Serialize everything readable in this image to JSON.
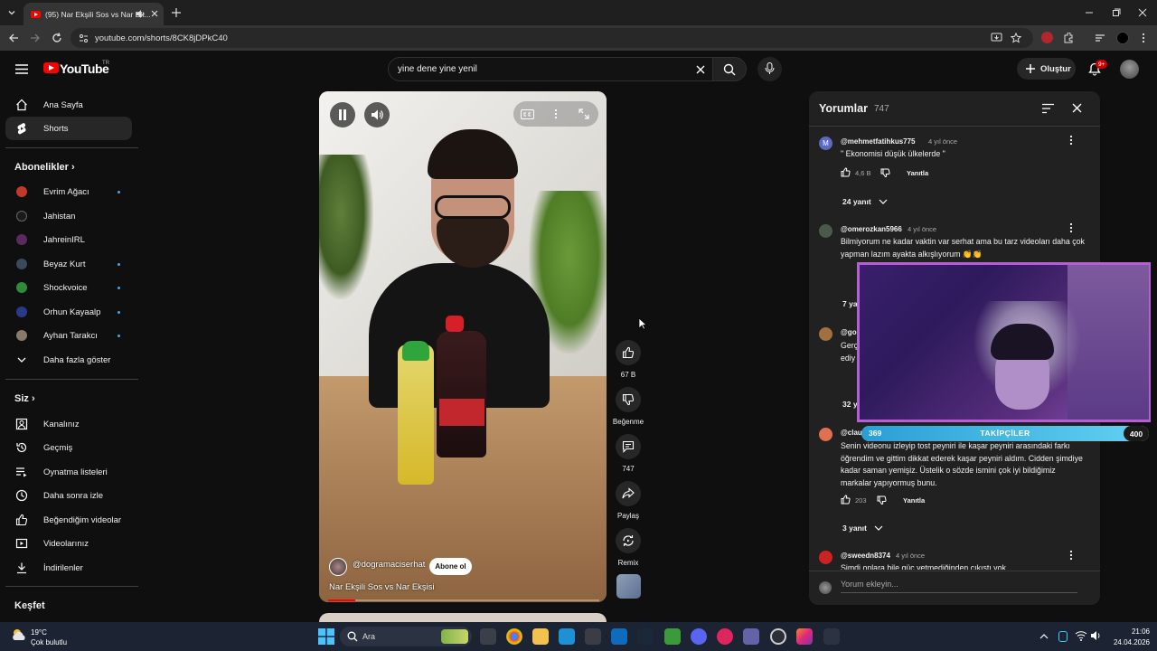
{
  "browser": {
    "tab_title": "(95) Nar Ekşili Sos vs Nar Ek...",
    "url": "youtube.com/shorts/8CK8jDPkC40"
  },
  "youtube": {
    "logo": "YouTube",
    "logo_region": "TR",
    "search_value": "yine dene yine yenil",
    "create_label": "Oluştur",
    "notification_badge": "9+"
  },
  "sidebar": {
    "main": [
      {
        "label": "Ana Sayfa",
        "icon": "home-icon"
      },
      {
        "label": "Shorts",
        "icon": "shorts-icon"
      }
    ],
    "subscriptions_heading": "Abonelikler",
    "subscriptions": [
      {
        "label": "Evrim Ağacı",
        "color": "#c0392b",
        "dot": true
      },
      {
        "label": "Jahistan",
        "color": "#1a1a1a",
        "dot": false
      },
      {
        "label": "JahreinIRL",
        "color": "#5b2a5e",
        "dot": false
      },
      {
        "label": "Beyaz Kurt",
        "color": "#3a4a5a",
        "dot": true
      },
      {
        "label": "Shockvoice",
        "color": "#2e8b3a",
        "dot": true
      },
      {
        "label": "Orhun Kayaalp",
        "color": "#2a3a8a",
        "dot": true
      },
      {
        "label": "Ayhan Tarakcı",
        "color": "#8a7a6a",
        "dot": true
      }
    ],
    "show_more": "Daha fazla göster",
    "you_heading": "Siz",
    "you_items": [
      {
        "label": "Kanalınız",
        "icon": "channel-icon"
      },
      {
        "label": "Geçmiş",
        "icon": "history-icon"
      },
      {
        "label": "Oynatma listeleri",
        "icon": "playlists-icon"
      },
      {
        "label": "Daha sonra izle",
        "icon": "watch-later-icon"
      },
      {
        "label": "Beğendiğim videolar",
        "icon": "liked-videos-icon"
      },
      {
        "label": "Videolarınız",
        "icon": "your-videos-icon"
      },
      {
        "label": "İndirilenler",
        "icon": "downloads-icon"
      }
    ],
    "explore_heading": "Keşfet"
  },
  "short": {
    "channel": "@dogramaciserhat",
    "subscribe_label": "Abone ol",
    "title": "Nar Ekşili Sos vs Nar Ekşisi",
    "progress": 0.1
  },
  "actions": {
    "like_count": "67 B",
    "dislike_label": "Beğenme",
    "comment_count": "747",
    "share_label": "Paylaş",
    "remix_label": "Remix"
  },
  "comments": {
    "title": "Yorumlar",
    "count": "747",
    "input_placeholder": "Yorum ekleyin...",
    "items": [
      {
        "user": "@mehmetfatihkus775",
        "time": "4 yıl önce",
        "text": "\" Ekonomisi düşük ülkelerde \"",
        "likes": "4,6 B",
        "reply": "Yanıtla",
        "replies": "24 yanıt",
        "avatar_letter": "M",
        "avatar_color": "#5c6bc0"
      },
      {
        "user": "@omerozkan5966",
        "time": "4 yıl önce",
        "text": "Bilmiyorum ne kadar vaktin var serhat ama bu tarz videoları daha çok yapman lazım ayakta alkışlıyorum 👏👏",
        "likes": "",
        "reply": "",
        "replies": "7 yanıt",
        "avatar_letter": "",
        "avatar_color": "#4a5a4a"
      },
      {
        "user": "@go",
        "time": "",
        "text": "Gerç ediy",
        "likes": "",
        "reply": "",
        "replies": "32 y",
        "avatar_letter": "",
        "avatar_color": "#a07040"
      },
      {
        "user": "@clau",
        "time": "",
        "text": "Senin videonu izleyip tost peyniri ile kaşar peyniri arasındaki farkı öğrendim ve gittim dikkat ederek kaşar peyniri aldım. Cidden şimdiye kadar saman yemişiz. Üstelik o sözde ismini çok iyi bildiğimiz markalar yapıyormuş bunu.",
        "likes": "203",
        "reply": "Yanıtla",
        "replies": "3 yanıt",
        "avatar_letter": "",
        "avatar_color": "#e07050"
      },
      {
        "user": "@sweedn8374",
        "time": "4 yıl önce",
        "text": "Şimdi onlara bile güç yetmediğinden çıkıştı yok...",
        "likes": "",
        "reply": "",
        "replies": "",
        "avatar_letter": "",
        "avatar_color": "#cc2222"
      }
    ]
  },
  "stream_overlay": {
    "followers_label": "TAKİPÇİLER",
    "followers_current": "369",
    "followers_goal": "400",
    "followers_fraction": 0.92
  },
  "taskbar": {
    "weather_temp": "19°C",
    "weather_desc": "Çok bulutlu",
    "search_placeholder": "Ara",
    "time": "21:06",
    "date": "24.04.2026"
  }
}
